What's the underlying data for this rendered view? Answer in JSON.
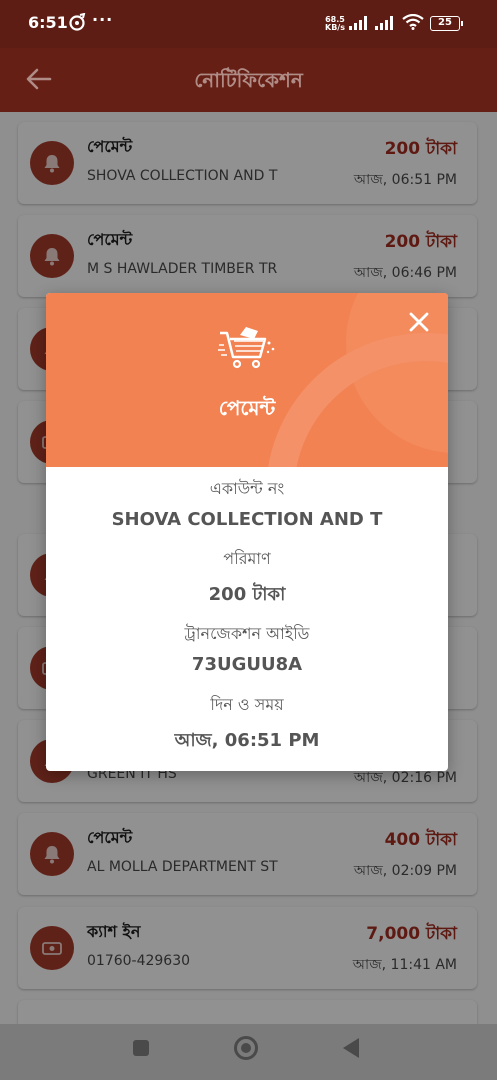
{
  "status_bar": {
    "time": "6:51",
    "more": "···",
    "speed_value": "68.5",
    "speed_unit": "KB/s",
    "battery": "25"
  },
  "app_bar": {
    "title": "নোটিফিকেশন"
  },
  "notifications": [
    {
      "title": "পেমেন্ট",
      "subtitle": "SHOVA COLLECTION AND T",
      "amount": "200 টাকা",
      "time": "আজ, 06:51 PM",
      "icon": "bell-icon"
    },
    {
      "title": "পেমেন্ট",
      "subtitle": "M S HAWLADER TIMBER TR",
      "amount": "200 টাকা",
      "time": "আজ, 06:46 PM",
      "icon": "bell-icon"
    },
    {
      "title": "",
      "subtitle": "",
      "amount": "",
      "time": "",
      "icon": "bell-icon"
    },
    {
      "title": "",
      "subtitle": "",
      "amount": "",
      "time": "",
      "icon": "cash-icon"
    },
    {
      "title": "",
      "subtitle": "",
      "amount": "",
      "time": "",
      "icon": "bell-icon"
    },
    {
      "title": "",
      "subtitle": "",
      "amount": "",
      "time": "",
      "icon": "cash-icon"
    },
    {
      "title": "",
      "subtitle": "GREEN IT HS",
      "amount": "",
      "time": "আজ, 02:16 PM",
      "icon": "bell-icon"
    },
    {
      "title": "পেমেন্ট",
      "subtitle": "AL MOLLA DEPARTMENT ST",
      "amount": "400 টাকা",
      "time": "আজ, 02:09 PM",
      "icon": "bell-icon"
    },
    {
      "title": "ক্যাশ ইন",
      "subtitle": "01760-429630",
      "amount": "7,000 টাকা",
      "time": "আজ, 11:41 AM",
      "icon": "cash-icon"
    }
  ],
  "modal": {
    "title": "পেমেন্ট",
    "account_label": "একাউন্ট নং",
    "account_value": "SHOVA COLLECTION AND T",
    "amount_label": "পরিমাণ",
    "amount_value": "200 টাকা",
    "txn_label": "ট্রানজেকশন আইডি",
    "txn_value": "73UGUU8A",
    "datetime_label": "দিন ও সময়",
    "datetime_value": "আজ, 06:51 PM"
  },
  "colors": {
    "primary": "#c0392b",
    "modal_header": "#f28252",
    "amount": "#c0392b"
  }
}
